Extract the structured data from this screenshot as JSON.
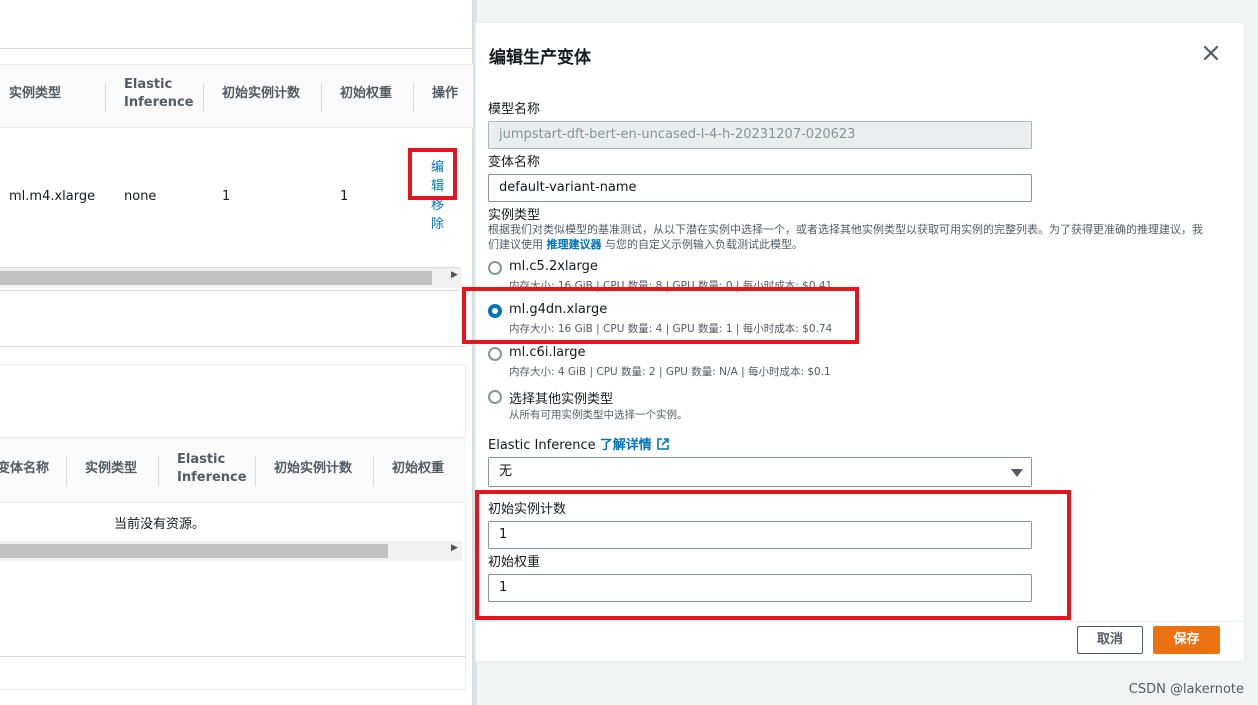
{
  "left_panel": {
    "table1": {
      "headers": [
        "实例类型",
        "Elastic Inference",
        "初始实例计数",
        "初始权重",
        "操作"
      ],
      "row": {
        "instance_type": "ml.m4.xlarge",
        "elastic_inference": "none",
        "instance_count": "1",
        "weight": "1",
        "edit_link": "编辑",
        "remove_link": "移除"
      }
    },
    "table2": {
      "headers": [
        "变体名称",
        "实例类型",
        "Elastic Inference",
        "初始实例计数",
        "初始权重"
      ],
      "empty_message": "当前没有资源。"
    }
  },
  "modal": {
    "title": "编辑生产变体",
    "model_name_label": "模型名称",
    "model_name_value": "jumpstart-dft-bert-en-uncased-l-4-h-20231207-020623",
    "variant_name_label": "变体名称",
    "variant_name_value": "default-variant-name",
    "instance_type_label": "实例类型",
    "instance_type_desc_part1": "根据我们对类似模型的基准测试，从以下潜在实例中选择一个，或者选择其他实例类型以获取可用实例的完整列表。为了获得更准确的推理建议，我",
    "instance_type_desc_part2": "们建议使用",
    "instance_type_desc_link": "推理建议器",
    "instance_type_desc_part3": "与您的自定义示例输入负载测试此模型。",
    "options": [
      {
        "label": "ml.c5.2xlarge",
        "desc": "内存大小: 16 GiB | CPU 数量: 8 | GPU 数量: 0 | 每小时成本: $0.41",
        "checked": false
      },
      {
        "label": "ml.g4dn.xlarge",
        "desc": "内存大小: 16 GiB | CPU 数量: 4 | GPU 数量: 1 | 每小时成本: $0.74",
        "checked": true
      },
      {
        "label": "ml.c6i.large",
        "desc": "内存大小: 4 GiB | CPU 数量: 2 | GPU 数量: N/A | 每小时成本: $0.1",
        "checked": false
      },
      {
        "label": "选择其他实例类型",
        "desc": "从所有可用实例类型中选择一个实例。",
        "checked": false
      }
    ],
    "elastic_inference_label": "Elastic Inference",
    "learn_more_link": "了解详情",
    "elastic_inference_selected": "无",
    "instance_count_label": "初始实例计数",
    "instance_count_value": "1",
    "weight_label": "初始权重",
    "weight_value": "1",
    "cancel_label": "取消",
    "save_label": "保存"
  },
  "watermark": "CSDN @lakernote",
  "colors": {
    "accent": "#0073bb",
    "primary_button": "#ec7211",
    "annotation_red": "#e8141d"
  },
  "icons": [
    "close-icon",
    "external-link-icon",
    "caret-down-icon",
    "scroll-right-arrow-icon"
  ]
}
